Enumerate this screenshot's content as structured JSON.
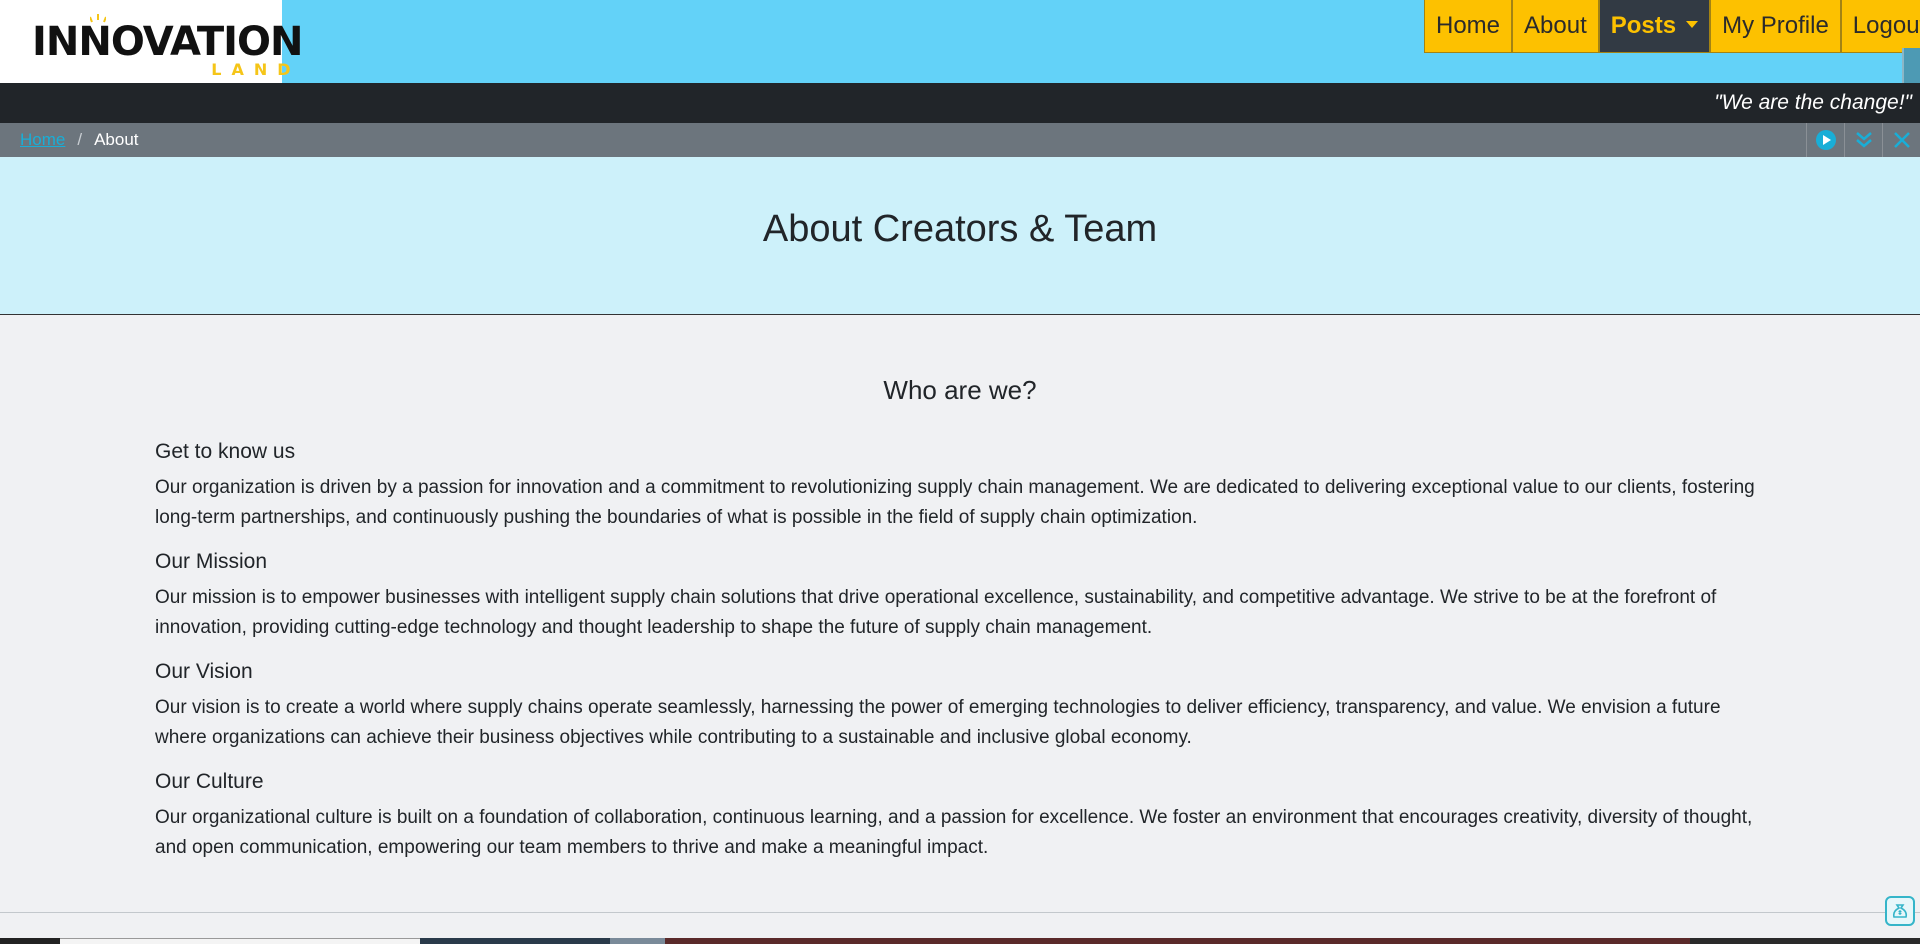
{
  "brand": {
    "logo_main": "INNOVATION",
    "logo_sub": "LAND",
    "accent": "#fdc100"
  },
  "nav": {
    "items": [
      {
        "label": "Home"
      },
      {
        "label": "About"
      },
      {
        "label": "Posts"
      },
      {
        "label": "My Profile"
      },
      {
        "label": "Logout"
      }
    ]
  },
  "tagline": "\"We are the change!\"",
  "breadcrumb": {
    "home": "Home",
    "current": "About",
    "separator": "/"
  },
  "hero": {
    "title": "About Creators & Team"
  },
  "main": {
    "heading": "Who are we?",
    "sections": [
      {
        "title": "Get to know us",
        "body": "Our organization is driven by a passion for innovation and a commitment to revolutionizing supply chain management. We are dedicated to delivering exceptional value to our clients, fostering long-term partnerships, and continuously pushing the boundaries of what is possible in the field of supply chain optimization."
      },
      {
        "title": "Our Mission",
        "body": "Our mission is to empower businesses with intelligent supply chain solutions that drive operational excellence, sustainability, and competitive advantage. We strive to be at the forefront of innovation, providing cutting-edge technology and thought leadership to shape the future of supply chain management."
      },
      {
        "title": "Our Vision",
        "body": "Our vision is to create a world where supply chains operate seamlessly, harnessing the power of emerging technologies to deliver efficiency, transparency, and value. We envision a future where organizations can achieve their business objectives while contributing to a sustainable and inclusive global economy."
      },
      {
        "title": "Our Culture",
        "body": "Our organizational culture is built on a foundation of collaboration, continuous learning, and a passion for excellence. We foster an environment that encourages creativity, diversity of thought, and open communication, empowering our team members to thrive and make a meaningful impact."
      }
    ]
  },
  "icons": {
    "tools": [
      "play-icon",
      "double-chevron-down-icon",
      "close-icon"
    ],
    "corner": "money-bag-icon"
  }
}
